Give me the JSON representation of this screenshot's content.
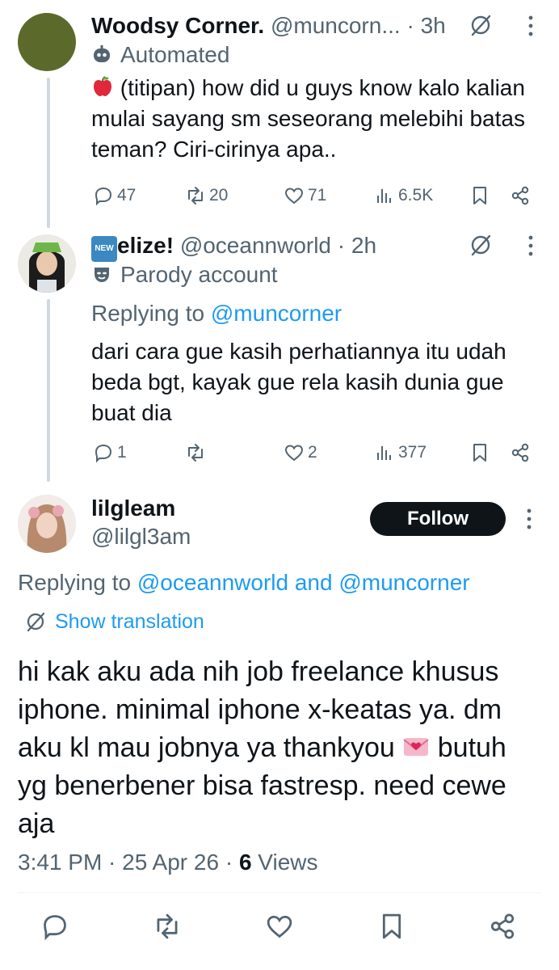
{
  "thread": [
    {
      "name": "Woodsy Corner.",
      "handle": "@muncorn...",
      "time": "3h",
      "badge": "Automated",
      "badge_icon": "robot-icon",
      "text": "(titipan) how did u guys know kalo kalian mulai sayang sm seseorang melebihi batas teman? Ciri-cirinya apa..",
      "lead_emoji": "apple",
      "replies": "47",
      "reposts": "20",
      "likes": "71",
      "views": "6.5K"
    },
    {
      "name_badge": "NEW",
      "name": "elize!",
      "handle": "@oceannworld",
      "time": "2h",
      "badge": "Parody account",
      "badge_icon": "theater-mask-icon",
      "replying_prefix": "Replying to ",
      "replying_to": "@muncorner",
      "text": "dari cara gue kasih perhatiannya itu udah beda bgt, kayak gue rela kasih dunia gue buat dia",
      "replies": "1",
      "reposts": "",
      "likes": "2",
      "views": "377"
    }
  ],
  "main": {
    "name": "lilgleam",
    "handle": "@lilgl3am",
    "follow_label": "Follow",
    "replying_prefix": "Replying to ",
    "replying_to": "@oceannworld and @muncorner",
    "translate_label": "Show translation",
    "text_before_emoji": "hi kak aku ada nih job freelance khusus iphone. minimal iphone x-keatas ya. dm aku kl mau jobnya ya thankyou",
    "text_after_emoji": "butuh yg benerbener bisa fastresp. need cewe aja",
    "time": "3:41 PM",
    "date": "25 Apr 26",
    "views_count": "6",
    "views_label": "Views"
  },
  "colors": {
    "accent": "#1d9bf0",
    "text": "#0f1419",
    "muted": "#536471",
    "thread_line": "#cfd9de",
    "follow_bg": "#0f1419"
  }
}
